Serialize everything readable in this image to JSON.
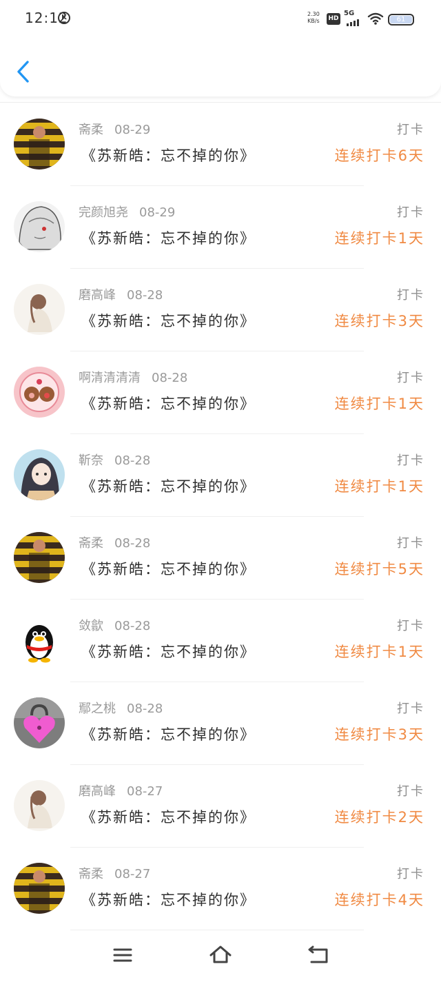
{
  "status_bar": {
    "time": "12:12",
    "k_badge": "K",
    "speed_value": "2.30",
    "speed_unit": "KB/s",
    "hd_label": "HD",
    "network_label": "5G",
    "battery": "61"
  },
  "header": {
    "back_icon": "chevron-left-icon"
  },
  "colors": {
    "accent_blue": "#2196f3",
    "streak_orange": "#f08a43",
    "meta_gray": "#9a9a9a",
    "title_dark": "#2f2f2f"
  },
  "items": [
    {
      "name": "斋柔",
      "date": "08-29",
      "title": "《苏新皓：忘不掉的你》",
      "action": "打卡",
      "streak": "连续打卡6天",
      "avatar": "striped-avatar"
    },
    {
      "name": "完颜旭尧",
      "date": "08-29",
      "title": "《苏新皓：忘不掉的你》",
      "action": "打卡",
      "streak": "连续打卡1天",
      "avatar": "anime-white-hair-avatar"
    },
    {
      "name": "磨高峰",
      "date": "08-28",
      "title": "《苏新皓：忘不掉的你》",
      "action": "打卡",
      "streak": "连续打卡3天",
      "avatar": "girl-avatar"
    },
    {
      "name": "啊清清清清",
      "date": "08-28",
      "title": "《苏新皓：忘不掉的你》",
      "action": "打卡",
      "streak": "连续打卡1天",
      "avatar": "cute-bears-avatar"
    },
    {
      "name": "靳奈",
      "date": "08-28",
      "title": "《苏新皓：忘不掉的你》",
      "action": "打卡",
      "streak": "连续打卡1天",
      "avatar": "anime-girl-avatar"
    },
    {
      "name": "斋柔",
      "date": "08-28",
      "title": "《苏新皓：忘不掉的你》",
      "action": "打卡",
      "streak": "连续打卡5天",
      "avatar": "striped-avatar"
    },
    {
      "name": "敛歙",
      "date": "08-28",
      "title": "《苏新皓：忘不掉的你》",
      "action": "打卡",
      "streak": "连续打卡1天",
      "avatar": "penguin-avatar"
    },
    {
      "name": "鄢之桃",
      "date": "08-28",
      "title": "《苏新皓：忘不掉的你》",
      "action": "打卡",
      "streak": "连续打卡3天",
      "avatar": "heart-lock-avatar"
    },
    {
      "name": "磨高峰",
      "date": "08-27",
      "title": "《苏新皓：忘不掉的你》",
      "action": "打卡",
      "streak": "连续打卡2天",
      "avatar": "girl-avatar"
    },
    {
      "name": "斋柔",
      "date": "08-27",
      "title": "《苏新皓：忘不掉的你》",
      "action": "打卡",
      "streak": "连续打卡4天",
      "avatar": "striped-avatar"
    }
  ],
  "bottom_nav": {
    "menu_icon": "menu-icon",
    "home_icon": "home-icon",
    "back_icon": "back-icon"
  }
}
